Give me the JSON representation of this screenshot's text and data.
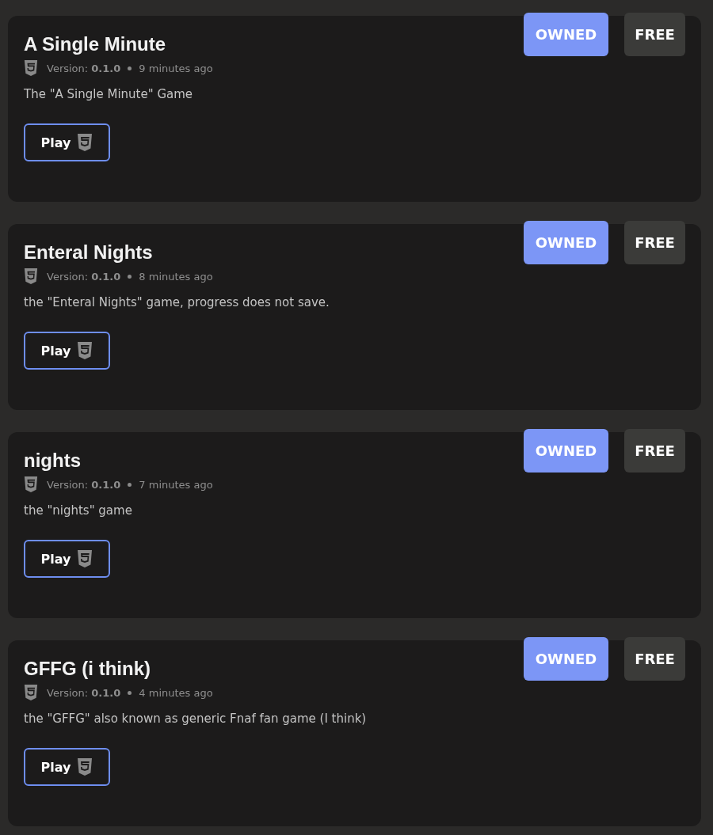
{
  "games": [
    {
      "title": "A Single Minute",
      "version": "Version: **0.1.0**",
      "updated": "9 minutes ago",
      "description": "The \"A Single Minute\" Game",
      "play": "Play",
      "badges": [
        {
          "label": "OWNED",
          "kind": "owned"
        },
        {
          "label": "FREE",
          "kind": "price"
        }
      ]
    },
    {
      "title": "Enteral Nights",
      "version": "Version: **0.1.0**",
      "updated": "8 minutes ago",
      "description": "the \"Enteral Nights\" game, progress does not save.",
      "play": "Play",
      "badges": [
        {
          "label": "OWNED",
          "kind": "owned"
        },
        {
          "label": "FREE",
          "kind": "price"
        }
      ]
    },
    {
      "title": "nights",
      "version": "Version: **0.1.0**",
      "updated": "7 minutes ago",
      "description": "the \"nights\" game",
      "play": "Play",
      "badges": [
        {
          "label": "OWNED",
          "kind": "owned"
        },
        {
          "label": "FREE",
          "kind": "price"
        }
      ]
    },
    {
      "title": "GFFG (i think)",
      "version": "Version: **0.1.0**",
      "updated": "4 minutes ago",
      "description": "the \"GFFG\" also known as generic Fnaf fan game (I think)",
      "play": "Play",
      "badges": [
        {
          "label": "OWNED",
          "kind": "owned"
        },
        {
          "label": "FREE",
          "kind": "price"
        }
      ]
    }
  ]
}
